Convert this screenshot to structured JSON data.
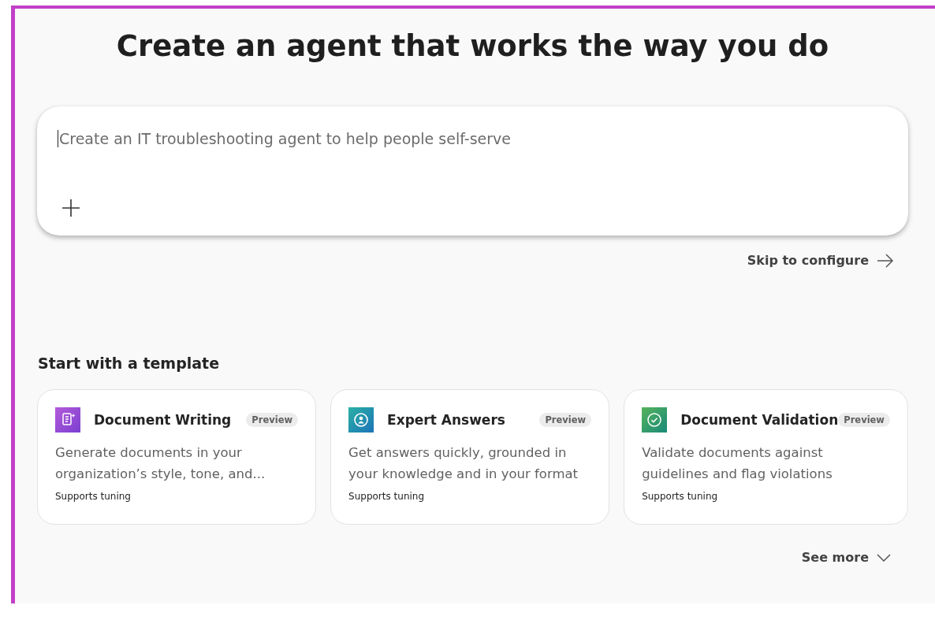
{
  "heading": "Create an agent that works the way you do",
  "prompt": {
    "placeholder": "Create an IT troubleshooting agent to help people self-serve"
  },
  "skip_link": {
    "label": "Skip to configure"
  },
  "templates_section": {
    "title": "Start with a template",
    "cards": [
      {
        "kind": "document",
        "title": "Document Writing",
        "badge": "Preview",
        "description": "Generate documents in your organization’s style, tone, and...",
        "footnote": "Supports tuning"
      },
      {
        "kind": "person",
        "title": "Expert Answers",
        "badge": "Preview",
        "description": "Get answers quickly, grounded in your knowledge and in your format",
        "footnote": "Supports tuning"
      },
      {
        "kind": "check",
        "title": "Document Validation",
        "badge": "Preview",
        "description": "Validate documents against guidelines and flag violations",
        "footnote": "Supports tuning"
      }
    ]
  },
  "see_more": {
    "label": "See more"
  }
}
